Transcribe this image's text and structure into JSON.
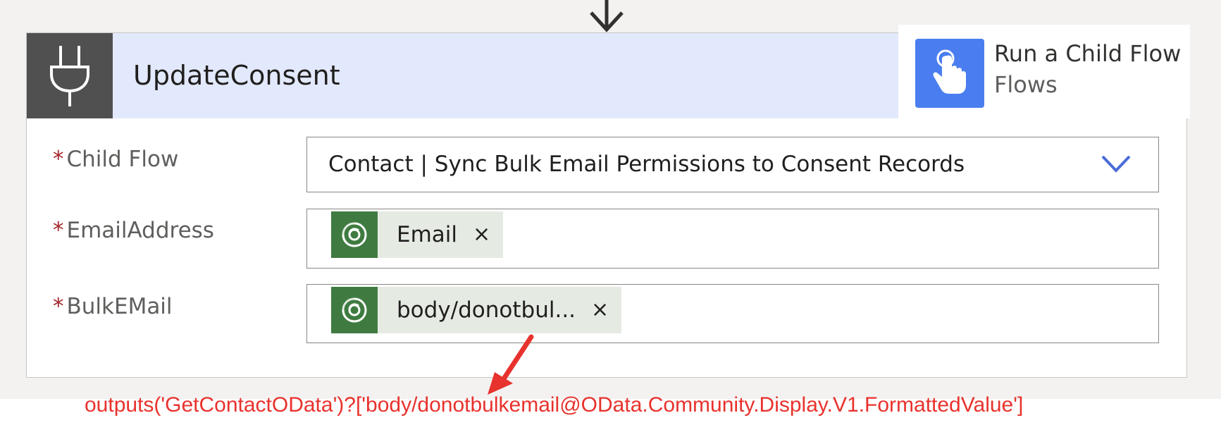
{
  "flow_connector": {
    "icon": "arrow-down-icon"
  },
  "action_card": {
    "title": "UpdateConsent",
    "icon": "plug-icon",
    "header_color": "#e3e9fc",
    "icon_bg_color": "#505050"
  },
  "tooltip": {
    "title": "Run a Child Flow",
    "subtitle": "Flows",
    "icon": "hand-pointer-icon",
    "icon_bg_color": "#4a7ef0"
  },
  "fields": {
    "child_flow": {
      "required_marker": "*",
      "label": "Child Flow",
      "value": "Contact | Sync Bulk Email Permissions to Consent Records",
      "dropdown_icon": "chevron-down-icon"
    },
    "email_address": {
      "required_marker": "*",
      "label": "EmailAddress",
      "token": {
        "label": "Email",
        "remove": "×",
        "icon": "dataverse-icon",
        "icon_bg_color": "#3f7b41"
      }
    },
    "bulk_email": {
      "required_marker": "*",
      "label": "BulkEMail",
      "token": {
        "label": "body/donotbul...",
        "remove": "×",
        "icon": "dataverse-icon",
        "icon_bg_color": "#3f7b41"
      }
    }
  },
  "annotation": {
    "expression": "outputs('GetContactOData')?['body/donotbulkemail@OData.Community.Display.V1.FormattedValue']",
    "color": "#e8322d"
  }
}
